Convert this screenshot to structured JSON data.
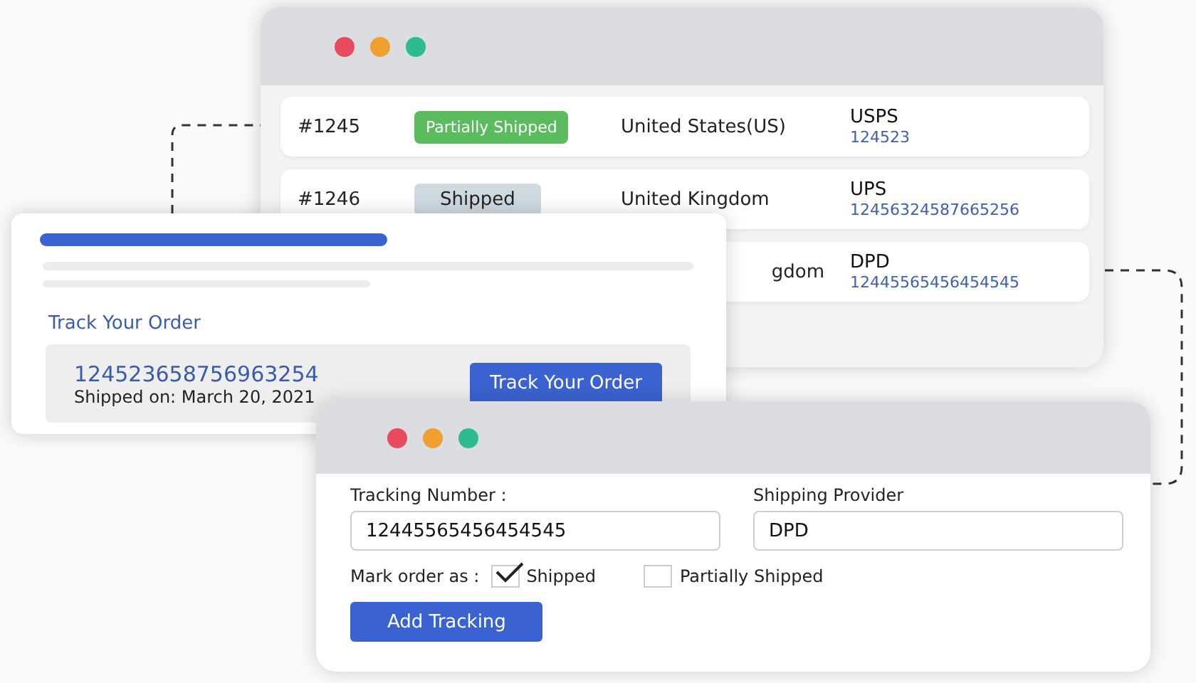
{
  "orders_window": {
    "rows": [
      {
        "order": "#1245",
        "status": {
          "label": "Partially Shipped",
          "kind": "partial"
        },
        "country": "United States(US)",
        "carrier": "USPS",
        "tracking": "124523"
      },
      {
        "order": "#1246",
        "status": {
          "label": "Shipped",
          "kind": "shipped"
        },
        "country": "United Kingdom",
        "carrier": "UPS",
        "tracking": "12456324587665256"
      },
      {
        "country": "gdom",
        "carrier": "DPD",
        "tracking": "12445565456454545"
      }
    ]
  },
  "track_card": {
    "link": "Track Your Order",
    "tracking_number": "124523658756963254",
    "shipped_on": "Shipped on: March 20, 2021",
    "button": "Track Your Order"
  },
  "form_window": {
    "tracking_label": "Tracking Number :",
    "tracking_value": "12445565456454545",
    "provider_label": "Shipping Provider",
    "provider_value": "DPD",
    "mark_label": "Mark order as :",
    "options": [
      {
        "label": "Shipped",
        "checked": true
      },
      {
        "label": "Partially Shipped",
        "checked": false
      }
    ],
    "button": "Add Tracking"
  }
}
